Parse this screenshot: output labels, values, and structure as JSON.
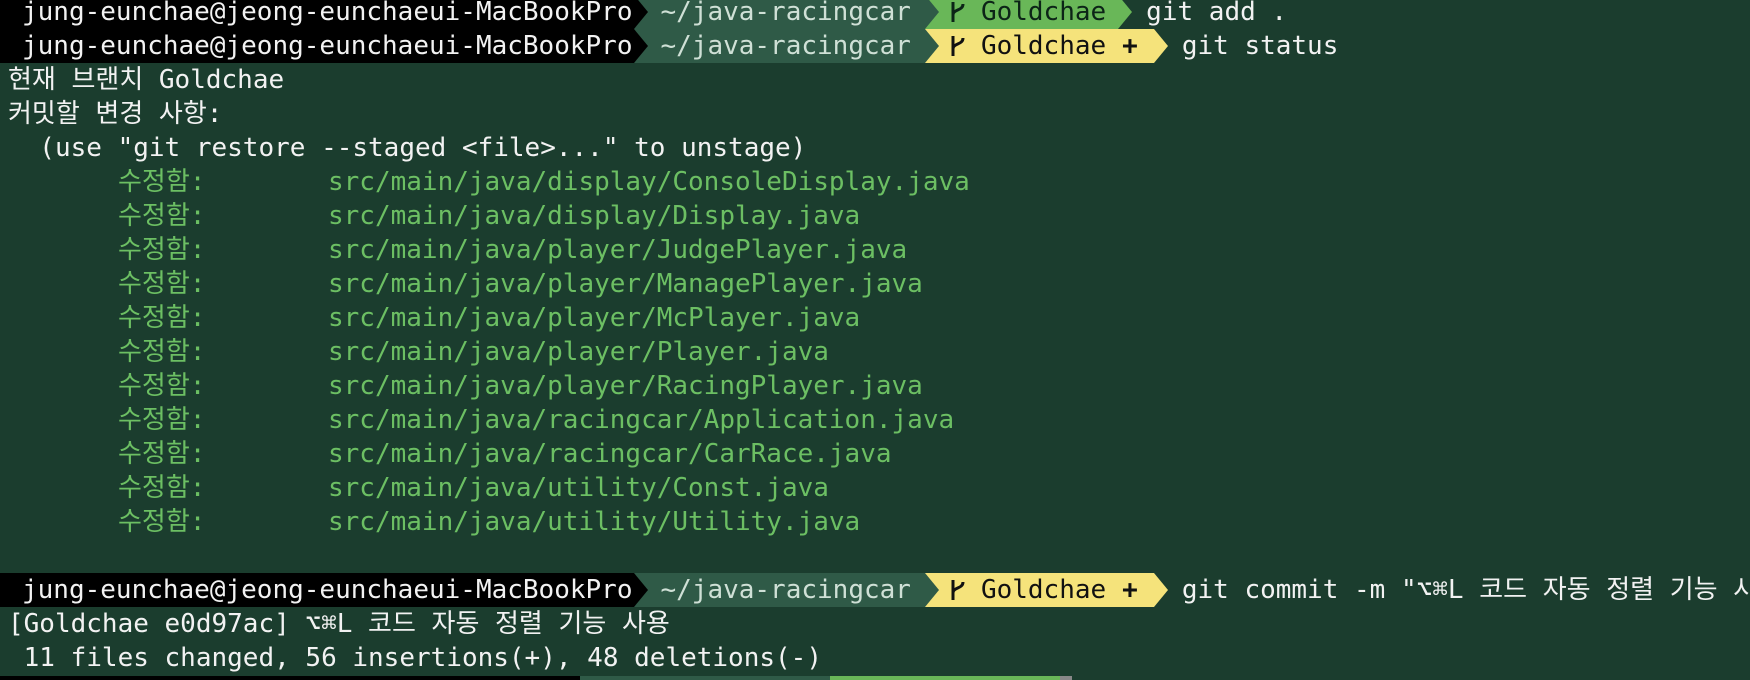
{
  "prompts": [
    {
      "user": "jung-eunchae@jeong-eunchaeui-MacBookPro",
      "dir": "~/java-racingcar",
      "branch": "Goldchae",
      "dirty": "",
      "command": "git add ."
    },
    {
      "user": "jung-eunchae@jeong-eunchaeui-MacBookPro",
      "dir": "~/java-racingcar",
      "branch": "Goldchae",
      "dirty": "+",
      "command": "git status"
    },
    {
      "user": "jung-eunchae@jeong-eunchaeui-MacBookPro",
      "dir": "~/java-racingcar",
      "branch": "Goldchae",
      "dirty": "+",
      "command": "git commit -m \"⌥⌘L 코드 자동 정렬 기능 사용\""
    }
  ],
  "status_output": {
    "branch_line": "현재 브랜치 Goldchae",
    "staged_header": "커밋할 변경 사항:",
    "hint": "  (use \"git restore --staged <file>...\" to unstage)",
    "modified_label": "수정함:",
    "files": [
      "src/main/java/display/ConsoleDisplay.java",
      "src/main/java/display/Display.java",
      "src/main/java/player/JudgePlayer.java",
      "src/main/java/player/ManagePlayer.java",
      "src/main/java/player/McPlayer.java",
      "src/main/java/player/Player.java",
      "src/main/java/player/RacingPlayer.java",
      "src/main/java/racingcar/Application.java",
      "src/main/java/racingcar/CarRace.java",
      "src/main/java/utility/Const.java",
      "src/main/java/utility/Utility.java"
    ]
  },
  "commit_output": {
    "line1": "[Goldchae e0d97ac] ⌥⌘L 코드 자동 정렬 기능 사용",
    "line2": " 11 files changed, 56 insertions(+), 48 deletions(-)"
  },
  "colors": {
    "background": "#1b3d2e",
    "user_segment": "#000000",
    "dir_segment": "#2f5a47",
    "branch_clean": "#69b758",
    "branch_dirty": "#f5e37b",
    "modified_text": "#6cbf63"
  },
  "icons": {
    "branch": "git-branch-icon"
  }
}
